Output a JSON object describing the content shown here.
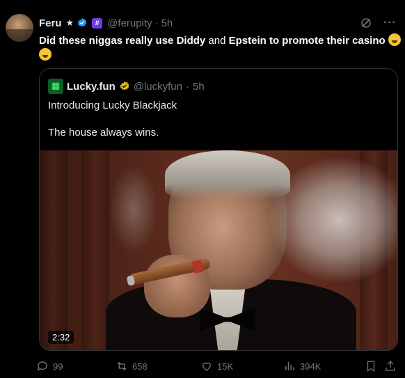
{
  "author": {
    "name": "Feru",
    "handle": "@ferupity",
    "time": "5h"
  },
  "tweet": {
    "text_bold_1": "Did these niggas really use Diddy",
    "text_plain_1": " and ",
    "text_bold_2": "Epstein to promote their casino ",
    "emoji": "loudly-crying-face"
  },
  "quote": {
    "name": "Lucky.fun",
    "handle": "@luckyfun",
    "time": "5h",
    "line1": "Introducing Lucky Blackjack",
    "line2": "The house always wins.",
    "media": {
      "duration": "2:32"
    }
  },
  "actions": {
    "replies": "99",
    "reposts": "658",
    "likes": "15K",
    "views": "394K"
  },
  "colors": {
    "background": "#000000",
    "muted": "#71767b",
    "verified_blue": "#1d9bf0",
    "verified_gold": "#e2b719",
    "border": "#2f3336"
  },
  "icons": {
    "top_right": [
      "grok-icon",
      "more-icon"
    ],
    "actions": [
      "reply-icon",
      "repost-icon",
      "like-icon",
      "views-icon",
      "bookmark-icon",
      "share-icon"
    ]
  }
}
